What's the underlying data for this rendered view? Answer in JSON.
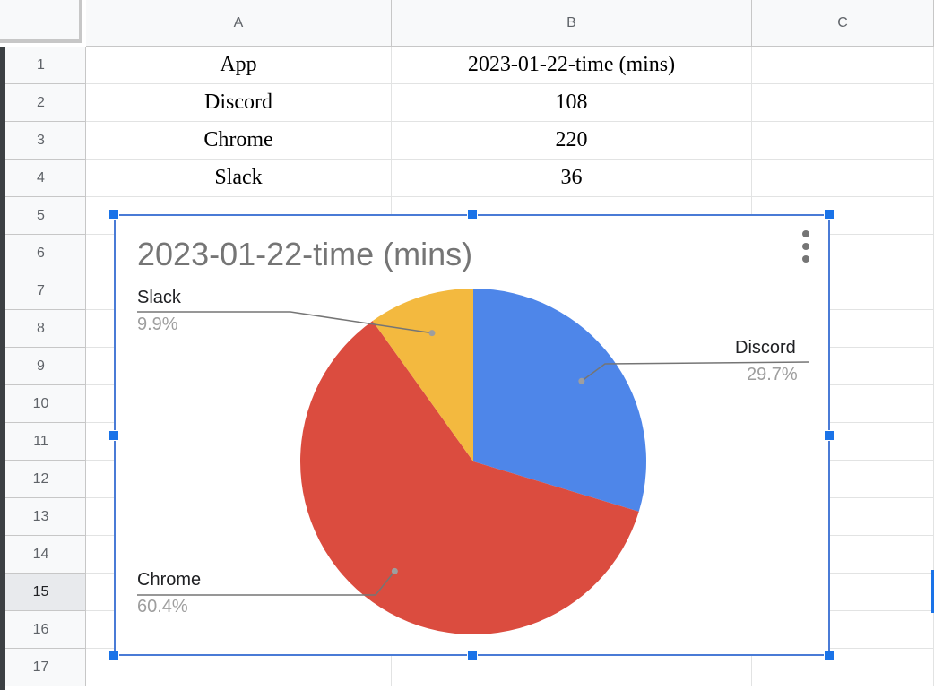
{
  "columns": [
    "A",
    "B",
    "C"
  ],
  "rows": [
    "1",
    "2",
    "3",
    "4",
    "5",
    "6",
    "7",
    "8",
    "9",
    "10",
    "11",
    "12",
    "13",
    "14",
    "15",
    "16",
    "17"
  ],
  "selected_row": "15",
  "table": {
    "header": [
      "App",
      "2023-01-22-time (mins)"
    ],
    "body": [
      [
        "Discord",
        "108"
      ],
      [
        "Chrome",
        "220"
      ],
      [
        "Slack",
        "36"
      ]
    ]
  },
  "chart": {
    "title": "2023-01-22-time (mins)",
    "menu_icon": "kebab-menu-icon",
    "labels": {
      "slack": {
        "name": "Slack",
        "pct": "9.9%"
      },
      "discord": {
        "name": "Discord",
        "pct": "29.7%"
      },
      "chrome": {
        "name": "Chrome",
        "pct": "60.4%"
      }
    }
  },
  "chart_data": {
    "type": "pie",
    "title": "2023-01-22-time (mins)",
    "categories": [
      "Discord",
      "Chrome",
      "Slack"
    ],
    "values": [
      108,
      220,
      36
    ],
    "percentages": [
      29.7,
      60.4,
      9.9
    ],
    "colors": [
      "#4e86e9",
      "#db4c3f",
      "#f3b93f"
    ],
    "legend": "labels"
  }
}
